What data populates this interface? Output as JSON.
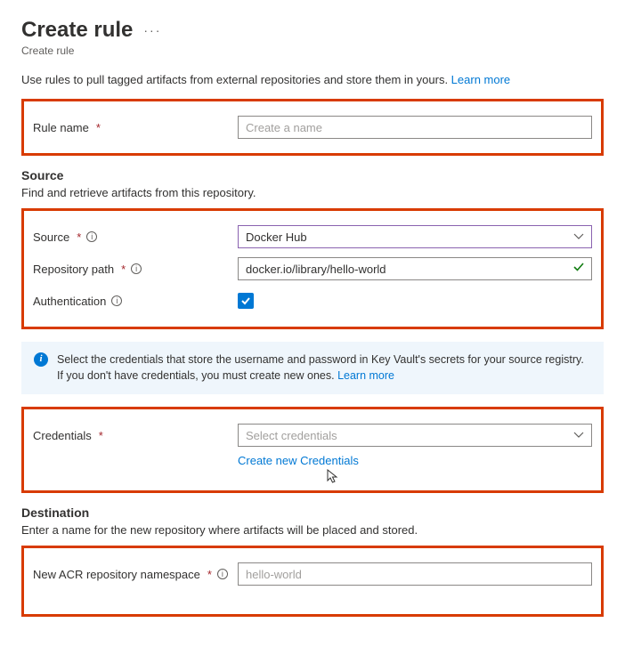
{
  "header": {
    "title": "Create rule",
    "subtitle": "Create rule"
  },
  "intro": {
    "text": "Use rules to pull tagged artifacts from external repositories and store them in yours. ",
    "learn_more": "Learn more"
  },
  "fields": {
    "rule_name": {
      "label": "Rule name",
      "placeholder": "Create a name",
      "value": ""
    }
  },
  "source": {
    "heading": "Source",
    "desc": "Find and retrieve artifacts from this repository.",
    "source_label": "Source",
    "source_value": "Docker Hub",
    "repo_path_label": "Repository path",
    "repo_path_value": "docker.io/library/hello-world",
    "auth_label": "Authentication",
    "auth_checked": true
  },
  "banner": {
    "text": "Select the credentials that store the username and password in Key Vault's secrets for your source registry. If you don't have credentials, you must create new ones. ",
    "learn_more": "Learn more"
  },
  "credentials": {
    "label": "Credentials",
    "placeholder": "Select credentials",
    "create_link": "Create new Credentials"
  },
  "destination": {
    "heading": "Destination",
    "desc": "Enter a name for the new repository where artifacts will be placed and stored.",
    "ns_label": "New ACR repository namespace",
    "ns_placeholder": "hello-world",
    "ns_value": ""
  }
}
